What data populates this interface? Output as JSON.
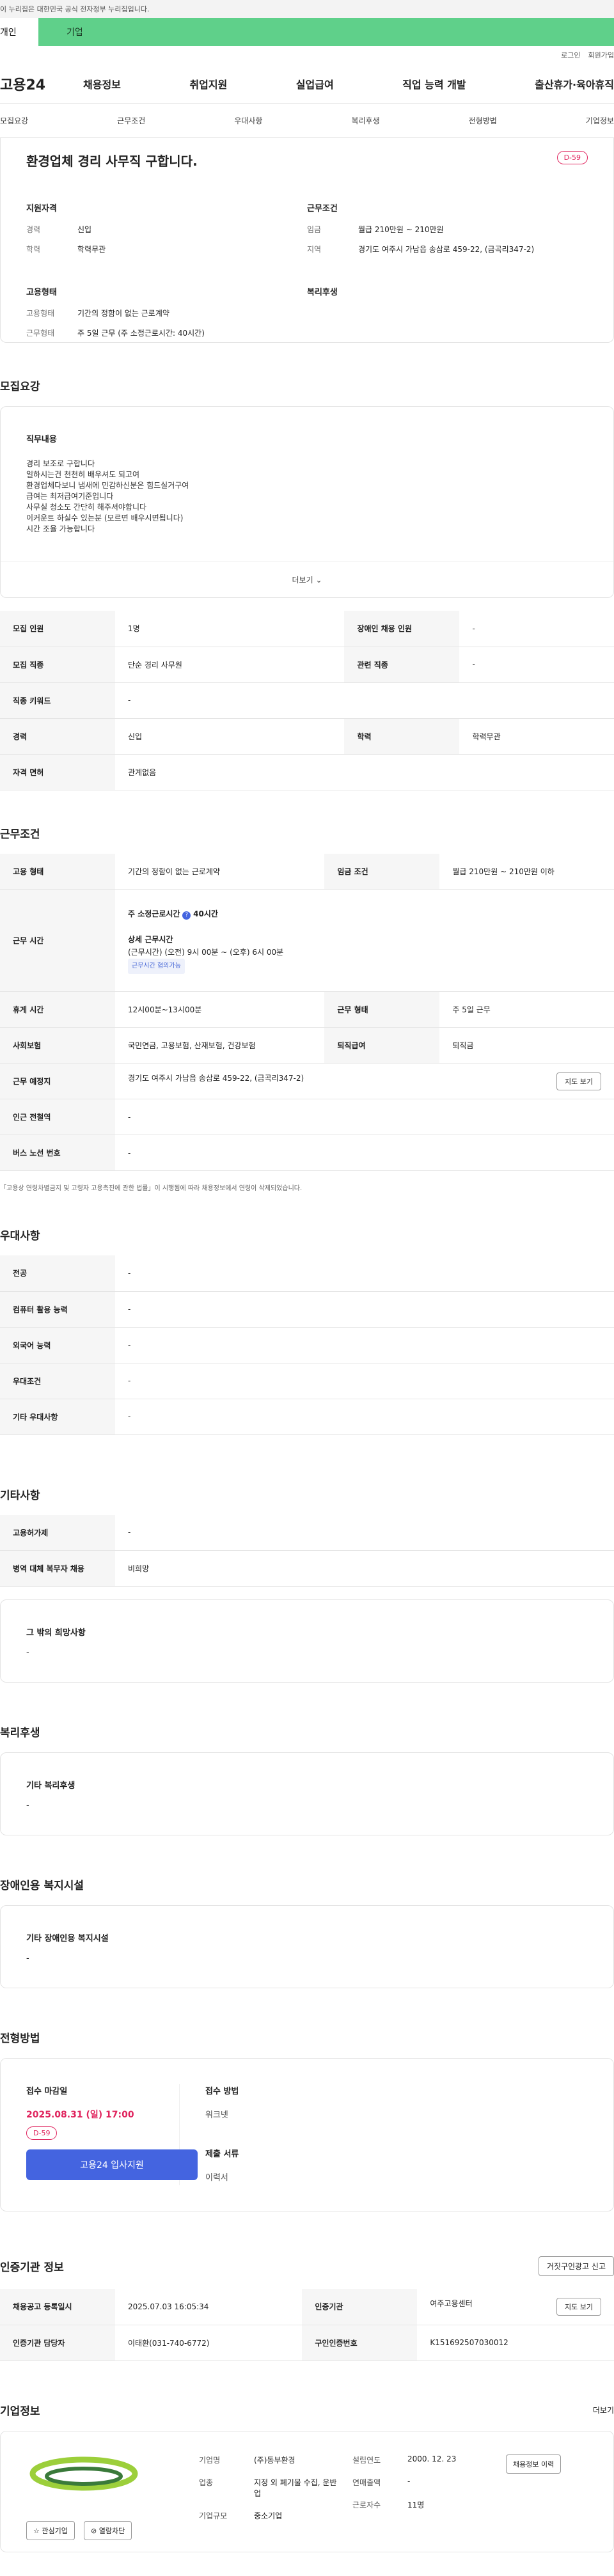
{
  "gov_banner": "이 누리집은 대한민국 공식 전자정부 누리집입니다.",
  "user_tabs": {
    "personal": "개인",
    "company": "기업"
  },
  "util_links": {
    "login": "로그인",
    "signup": "회원가입"
  },
  "logo": "고용24",
  "gnb": [
    "채용정보",
    "취업지원",
    "실업급여",
    "직업 능력 개발",
    "출산휴가·육아휴직"
  ],
  "subnav": [
    "모집요강",
    "근무조건",
    "우대사항",
    "복리후생",
    "전형방법",
    "기업정보"
  ],
  "summary": {
    "title": "환경업체 경리 사무직 구합니다.",
    "dday": "D-59",
    "qual_title": "지원자격",
    "qual": [
      {
        "k": "경력",
        "v": "신입"
      },
      {
        "k": "학력",
        "v": "학력무관"
      }
    ],
    "cond_title": "근무조건",
    "cond": [
      {
        "k": "임금",
        "v": "월급 210만원 ~ 210만원"
      },
      {
        "k": "지역",
        "v": "경기도 여주시 가남읍 송삼로 459-22, (금곡리347-2)"
      }
    ],
    "emp_title": "고용형태",
    "emp": [
      {
        "k": "고용형태",
        "v": "기간의 정함이 없는 근로계약"
      },
      {
        "k": "근무형태",
        "v": "주 5일 근무 (주 소정근로시간: 40시간)"
      }
    ],
    "welfare_title": "복리후생"
  },
  "recruit": {
    "title": "모집요강",
    "duty_title": "직무내용",
    "duty_body": "경리 보조로 구합니다\n일하시는건 천천히 배우셔도 되고여\n환경업체다보니 냄새에 민감하신분은 힘드실거구여\n급여는 최저급여기준입니다\n사무실 청소도 간단히 해주셔야합니다\n이커운트 하실수 있는분 (모르면 배우시면됩니다)\n시간 조율 가능합니다",
    "more": "더보기",
    "rows": [
      {
        "k1": "모집 인원",
        "v1": "1명",
        "k2": "장애인 채용 인원",
        "v2": "-"
      },
      {
        "k1": "모집 직종",
        "v1": "단순 경리 사무원",
        "k2": "관련 직종",
        "v2": "-"
      },
      {
        "k1": "직종 키워드",
        "v1": "-"
      },
      {
        "k1": "경력",
        "v1": "신입",
        "k2": "학력",
        "v2": "학력무관"
      },
      {
        "k1": "자격 면허",
        "v1": "관계없음"
      }
    ]
  },
  "work": {
    "title": "근무조건",
    "emp_k": "고용 형태",
    "emp_v": "기간의 정함이 없는 근로계약",
    "wage_k": "임금 조건",
    "wage_v": "월급 210만원 ~ 210만원 이하",
    "time_k": "근무 시간",
    "time_weekly": "주 소정근로시간",
    "time_weekly_v": "40시간",
    "time_detail_title": "상세 근무시간",
    "time_detail": "(근무시간) (오전) 9시 00분 ~ (오후) 6시 00분",
    "time_tag": "근무시간 협의가능",
    "break_k": "휴게 시간",
    "break_v": "12시00분~13시00분",
    "form_k": "근무 형태",
    "form_v": "주 5일 근무",
    "ins_k": "사회보험",
    "ins_v": "국민연금, 고용보험, 산재보험, 건강보험",
    "ret_k": "퇴직급여",
    "ret_v": "퇴직금",
    "place_k": "근무 예정지",
    "place_v": "경기도 여주시 가남읍 송삼로 459-22, (금곡리347-2)",
    "map_btn": "지도 보기",
    "subway_k": "인근 전철역",
    "subway_v": "-",
    "bus_k": "버스 노선 번호",
    "bus_v": "-",
    "note": "「고용상 연령차별금지 및 고령자 고용촉진에 관한 법률」이 시행됨에 따라 채용정보에서 연령이 삭제되었습니다."
  },
  "pref": {
    "title": "우대사항",
    "rows": [
      {
        "k": "전공",
        "v": "-"
      },
      {
        "k": "컴퓨터 활용 능력",
        "v": "-"
      },
      {
        "k": "외국어 능력",
        "v": "-"
      },
      {
        "k": "우대조건",
        "v": "-"
      },
      {
        "k": "기타 우대사항",
        "v": "-"
      }
    ]
  },
  "etc": {
    "title": "기타사항",
    "rows": [
      {
        "k": "고용허가제",
        "v": "-"
      },
      {
        "k": "병역 대체 복무자 채용",
        "v": "비희망"
      }
    ],
    "hope_title": "그 밖의 희망사항",
    "hope_v": "-"
  },
  "welfare": {
    "title": "복리후생",
    "sub": "기타 복리후생",
    "v": "-"
  },
  "disabled": {
    "title": "장애인용 복지시설",
    "sub": "기타 장애인용 복지시설",
    "v": "-"
  },
  "screening": {
    "title": "전형방법",
    "deadline_t": "접수 마감일",
    "deadline_v": "2025.08.31 (일) 17:00",
    "dday": "D-59",
    "apply_btn": "고용24 입사지원",
    "method_t": "접수 방법",
    "method_v": "워크넷",
    "docs_t": "제출 서류",
    "docs_v": "이력서"
  },
  "agency": {
    "title": "인증기관 정보",
    "report_btn": "거짓구인광고 신고",
    "reg_k": "채용공고 등록일시",
    "reg_v": "2025.07.03 16:05:34",
    "org_k": "인증기관",
    "org_v": "여주고용센터",
    "map_btn": "지도 보기",
    "mgr_k": "인증기관 담당자",
    "mgr_v": "이태환(031-740-6772)",
    "no_k": "구인인증번호",
    "no_v": "K151692507030012"
  },
  "companyinfo": {
    "title": "기업정보",
    "more": "더보기",
    "fav_btn": "관심기업",
    "block_btn": "열람차단",
    "name_k": "기업명",
    "name_v": "(주)동부환경",
    "ind_k": "업종",
    "ind_v": "지정 외 폐기물 수집, 운반업",
    "size_k": "기업규모",
    "size_v": "중소기업",
    "year_k": "설립연도",
    "year_v": "2000. 12. 23",
    "sales_k": "연매출액",
    "sales_v": "-",
    "emp_k": "근로자수",
    "emp_v": "11명",
    "hist_btn": "채용정보 이력"
  }
}
